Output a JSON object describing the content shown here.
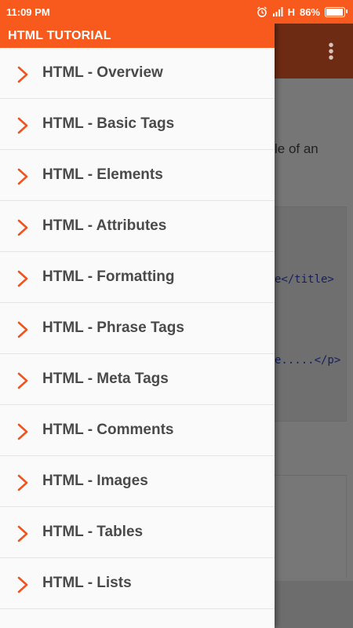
{
  "status": {
    "time": "11:09 PM",
    "network": "H",
    "battery": "86%",
    "battery_level": 0.86
  },
  "drawer": {
    "title": "HTML TUTORIAL",
    "items": [
      {
        "label": "HTML - Overview"
      },
      {
        "label": "HTML - Basic Tags"
      },
      {
        "label": "HTML - Elements"
      },
      {
        "label": "HTML - Attributes"
      },
      {
        "label": "HTML - Formatting"
      },
      {
        "label": "HTML - Phrase Tags"
      },
      {
        "label": "HTML - Meta Tags"
      },
      {
        "label": "HTML - Comments"
      },
      {
        "label": "HTML - Images"
      },
      {
        "label": "HTML - Tables"
      },
      {
        "label": "HTML - Lists"
      }
    ]
  },
  "background": {
    "text_fragment": "le of an",
    "code_line_1": "e</title>",
    "code_line_2": "e.....</p>"
  },
  "colors": {
    "accent": "#f85a1e",
    "chevron": "#f0541e",
    "item_text": "#4a4a4a"
  },
  "icons": {
    "menu_chevron": "chevron-right-icon",
    "more": "more-vert-icon",
    "alarm": "alarm-icon",
    "signal": "signal-icon",
    "battery": "battery-icon"
  }
}
